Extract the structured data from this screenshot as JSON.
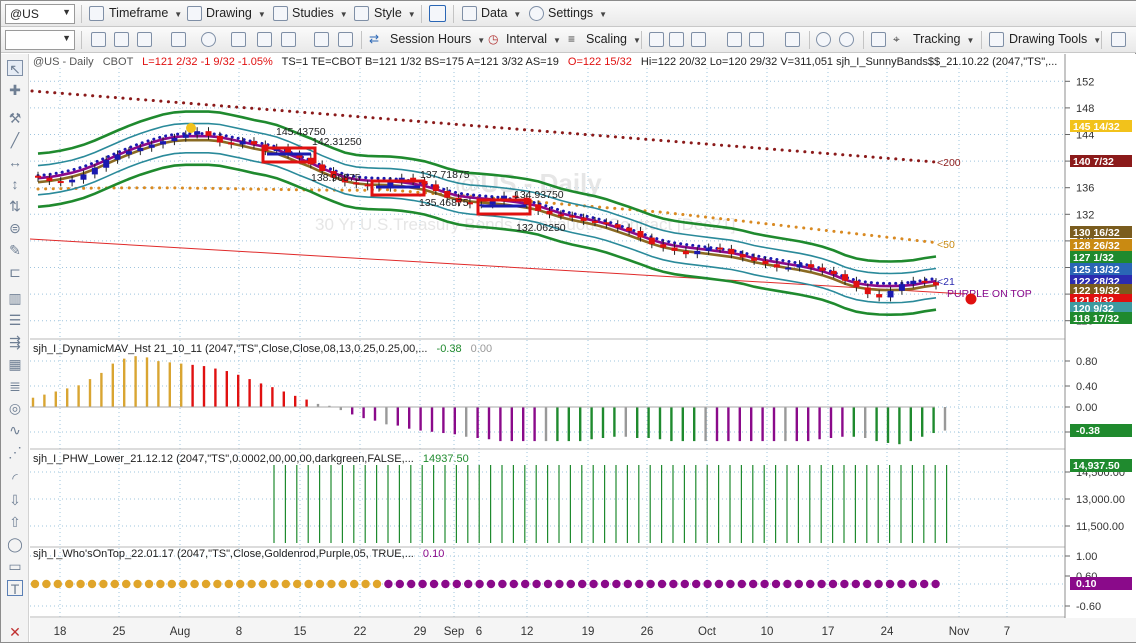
{
  "toolbar1": {
    "symbol": "@US",
    "menus": [
      "Timeframe",
      "Drawing",
      "Studies",
      "Style",
      "Data",
      "Settings"
    ]
  },
  "toolbar2": {
    "blank_combo": "",
    "session_hours": "Session Hours",
    "interval": "Interval",
    "scaling": "Scaling",
    "tracking": "Tracking",
    "drawing_tools": "Drawing Tools"
  },
  "price_panel": {
    "header": {
      "symbol": "@US - Daily",
      "exchange": "CBOT",
      "quote_red": "L=121 2/32   -1 9/32   -1.05%",
      "quote_black": "TS=1   TE=CBOT   B=121 1/32   BS=175   A=121 3/32   AS=19",
      "open": "O=122 15/32",
      "rest": "Hi=122 20/32   Lo=120 29/32   V=311,051   sjh_I_SunnyBands$$_21.10.22 (2047,\"TS\",..."
    },
    "watermark": {
      "title": "@US - Daily",
      "subtitle": "30 Yr U.S.Treasury Bonds Continuous Contract [Dec21]"
    },
    "axis_ticks": [
      "152",
      "148",
      "144",
      "140",
      "136",
      "132",
      "128",
      "124",
      "120",
      "116"
    ],
    "price_tags": [
      {
        "text": "145 14/32",
        "color": "#f2c21b",
        "fg": "#ffffff"
      },
      {
        "text": "140 7/32",
        "color": "#8b1a1a",
        "fg": "#ffffff"
      },
      {
        "text": "130 16/32",
        "color": "#7a5c1e",
        "fg": "#ffffff"
      },
      {
        "text": "128 26/32",
        "color": "#c98a12",
        "fg": "#ffffff"
      },
      {
        "text": "127 1/32",
        "color": "#1f8a2e",
        "fg": "#ffffff"
      },
      {
        "text": "125 13/32",
        "color": "#2a66b5",
        "fg": "#ffffff"
      },
      {
        "text": "122 28/32",
        "color": "#2b2bb0",
        "fg": "#ffffff"
      },
      {
        "text": "122 19/32",
        "color": "#7a5c1e",
        "fg": "#ffffff"
      },
      {
        "text": "121 8/32",
        "color": "#e01010",
        "fg": "#ffffff"
      },
      {
        "text": "120 9/32",
        "color": "#3d9aa0",
        "fg": "#ffffff"
      },
      {
        "text": "118 17/32",
        "color": "#1f8a2e",
        "fg": "#ffffff"
      }
    ],
    "annotations": [
      {
        "text": "145.43750",
        "color": "#222"
      },
      {
        "text": "142.31250",
        "color": "#222"
      },
      {
        "text": "138.96875",
        "color": "#222"
      },
      {
        "text": "137.71875",
        "color": "#222"
      },
      {
        "text": "135.46875",
        "color": "#222"
      },
      {
        "text": "134.93750",
        "color": "#222"
      },
      {
        "text": "132.06250",
        "color": "#222"
      }
    ],
    "ma_labels": [
      {
        "text": "<200",
        "color": "#8b1a1a"
      },
      {
        "text": "<50",
        "color": "#c98a12"
      },
      {
        "text": "<21",
        "color": "#2b2bb0"
      }
    ],
    "purple_on_top": "PURPLE ON TOP"
  },
  "panel2": {
    "header": "sjh_I_DynamicMAV_Hst 21_10_11 (2047,\"TS\",Close,Close,08,13,0.25,0.25,00,...",
    "value1": "-0.38",
    "value2": "0.00",
    "axis_ticks": [
      "0.80",
      "0.40",
      "0.00",
      "-0.40"
    ],
    "tag": "-0.38",
    "values": [
      0.15,
      0.2,
      0.25,
      0.3,
      0.35,
      0.45,
      0.55,
      0.7,
      0.78,
      0.82,
      0.8,
      0.74,
      0.72,
      0.7,
      0.68,
      0.66,
      0.62,
      0.58,
      0.52,
      0.45,
      0.38,
      0.32,
      0.25,
      0.18,
      0.12,
      0.05,
      0.02,
      -0.05,
      -0.12,
      -0.18,
      -0.22,
      -0.28,
      -0.3,
      -0.35,
      -0.38,
      -0.4,
      -0.42,
      -0.44,
      -0.48,
      -0.5,
      -0.52,
      -0.55,
      -0.55,
      -0.55,
      -0.55,
      -0.55,
      -0.55,
      -0.55,
      -0.55,
      -0.52,
      -0.5,
      -0.48,
      -0.48,
      -0.5,
      -0.5,
      -0.52,
      -0.55,
      -0.55,
      -0.55,
      -0.55,
      -0.55,
      -0.55,
      -0.55,
      -0.55,
      -0.55,
      -0.55,
      -0.55,
      -0.55,
      -0.55,
      -0.52,
      -0.5,
      -0.48,
      -0.48,
      -0.5,
      -0.55,
      -0.58,
      -0.6,
      -0.55,
      -0.48,
      -0.42,
      -0.38
    ]
  },
  "panel3": {
    "header": "sjh_I_PHW_Lower_21.12.12 (2047,\"TS\",0.0002,00,00,00,darkgreen,FALSE,...",
    "value": "14937.50",
    "axis_ticks": [
      "14,500.00",
      "13,000.00",
      "11,500.00"
    ],
    "tag": "14,937.50"
  },
  "panel4": {
    "header": "sjh_I_Who'sOnTop_22.01.17 (2047,\"TS\",Close,Goldenrod,Purple,05, TRUE,...",
    "value": "0.10",
    "axis_ticks": [
      "1.00",
      "0.60",
      "0.10",
      "-0.60"
    ],
    "tag": "0.10"
  },
  "x_axis": {
    "labels": [
      "18",
      "25",
      "Aug",
      "8",
      "15",
      "22",
      "29",
      "Sep",
      "6",
      "12",
      "19",
      "26",
      "Oct",
      "10",
      "17",
      "24",
      "Nov",
      "7"
    ]
  },
  "chart_data": {
    "type": "candlestick",
    "title": "@US - Daily",
    "ylim": [
      114,
      154
    ],
    "ohlc_close": [
      137.5,
      137.0,
      136.8,
      137.2,
      138.0,
      139.0,
      140.2,
      141.0,
      141.5,
      142.0,
      142.5,
      143.0,
      143.5,
      144.0,
      144.5,
      143.8,
      142.8,
      142.5,
      143.0,
      142.5,
      141.5,
      142.0,
      141.0,
      140.5,
      139.5,
      138.5,
      137.5,
      136.8,
      136.5,
      136.2,
      136.0,
      137.0,
      137.5,
      137.0,
      136.5,
      135.5,
      134.5,
      133.8,
      133.5,
      133.5,
      134.0,
      134.8,
      134.5,
      133.5,
      132.5,
      132.0,
      131.8,
      131.5,
      131.0,
      130.8,
      130.5,
      130.0,
      129.5,
      128.5,
      127.5,
      127.0,
      126.5,
      126.0,
      126.5,
      127.0,
      126.8,
      126.0,
      125.5,
      125.0,
      124.5,
      124.0,
      124.0,
      124.5,
      124.0,
      123.5,
      123.0,
      122.0,
      121.0,
      120.0,
      119.5,
      120.5,
      121.5,
      122.0,
      121.8,
      121.3
    ]
  }
}
